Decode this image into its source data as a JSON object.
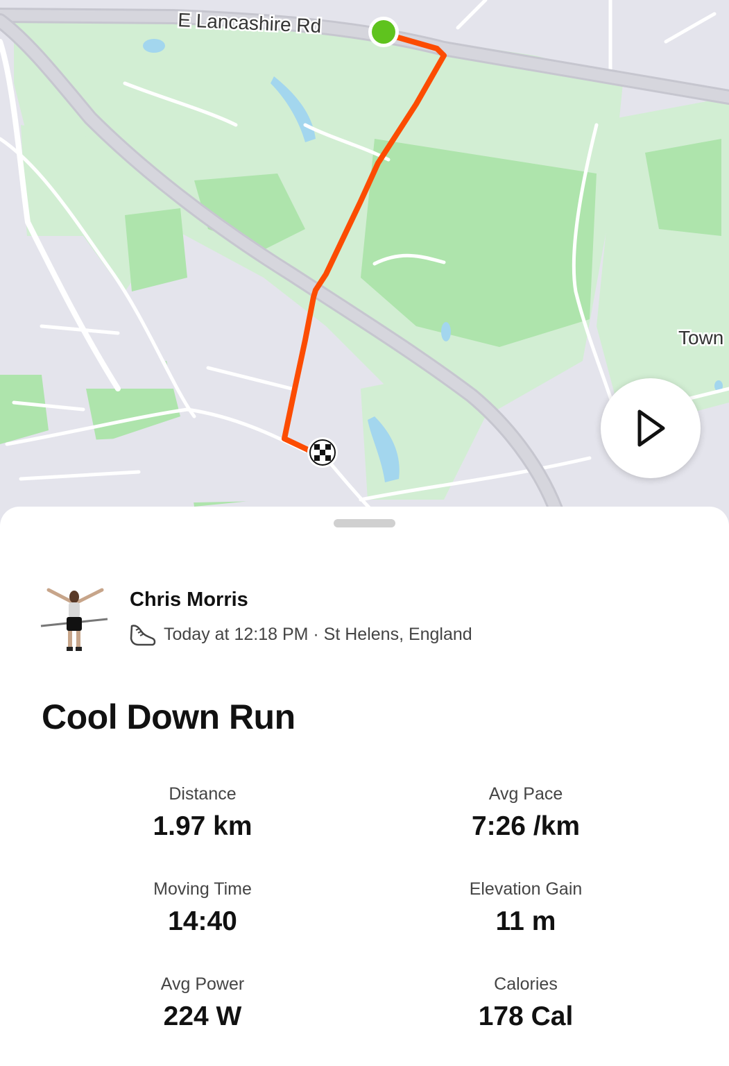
{
  "map": {
    "road_label_main": "E Lancashire Rd",
    "place_label_town": "Town",
    "colors": {
      "background": "#e4e4ec",
      "park_light": "#d2eed3",
      "park_dark": "#aee4ac",
      "water": "#a3d6ee",
      "road": "#ffffff",
      "major_road": "#cfcfd6",
      "route": "#fc4c02",
      "start_marker": "#5fc31e"
    },
    "icons": {
      "start": "start-dot-icon",
      "finish": "checkered-flag-icon",
      "play": "play-icon"
    }
  },
  "activity": {
    "athlete_name": "Chris Morris",
    "activity_icon": "running-shoe-icon",
    "meta": "Today at 12:18 PM · St Helens, England",
    "title": "Cool Down Run"
  },
  "stats": [
    {
      "label": "Distance",
      "value": "1.97 km"
    },
    {
      "label": "Avg Pace",
      "value": "7:26 /km"
    },
    {
      "label": "Moving Time",
      "value": "14:40"
    },
    {
      "label": "Elevation Gain",
      "value": "11 m"
    },
    {
      "label": "Avg Power",
      "value": "224 W"
    },
    {
      "label": "Calories",
      "value": "178 Cal"
    }
  ]
}
